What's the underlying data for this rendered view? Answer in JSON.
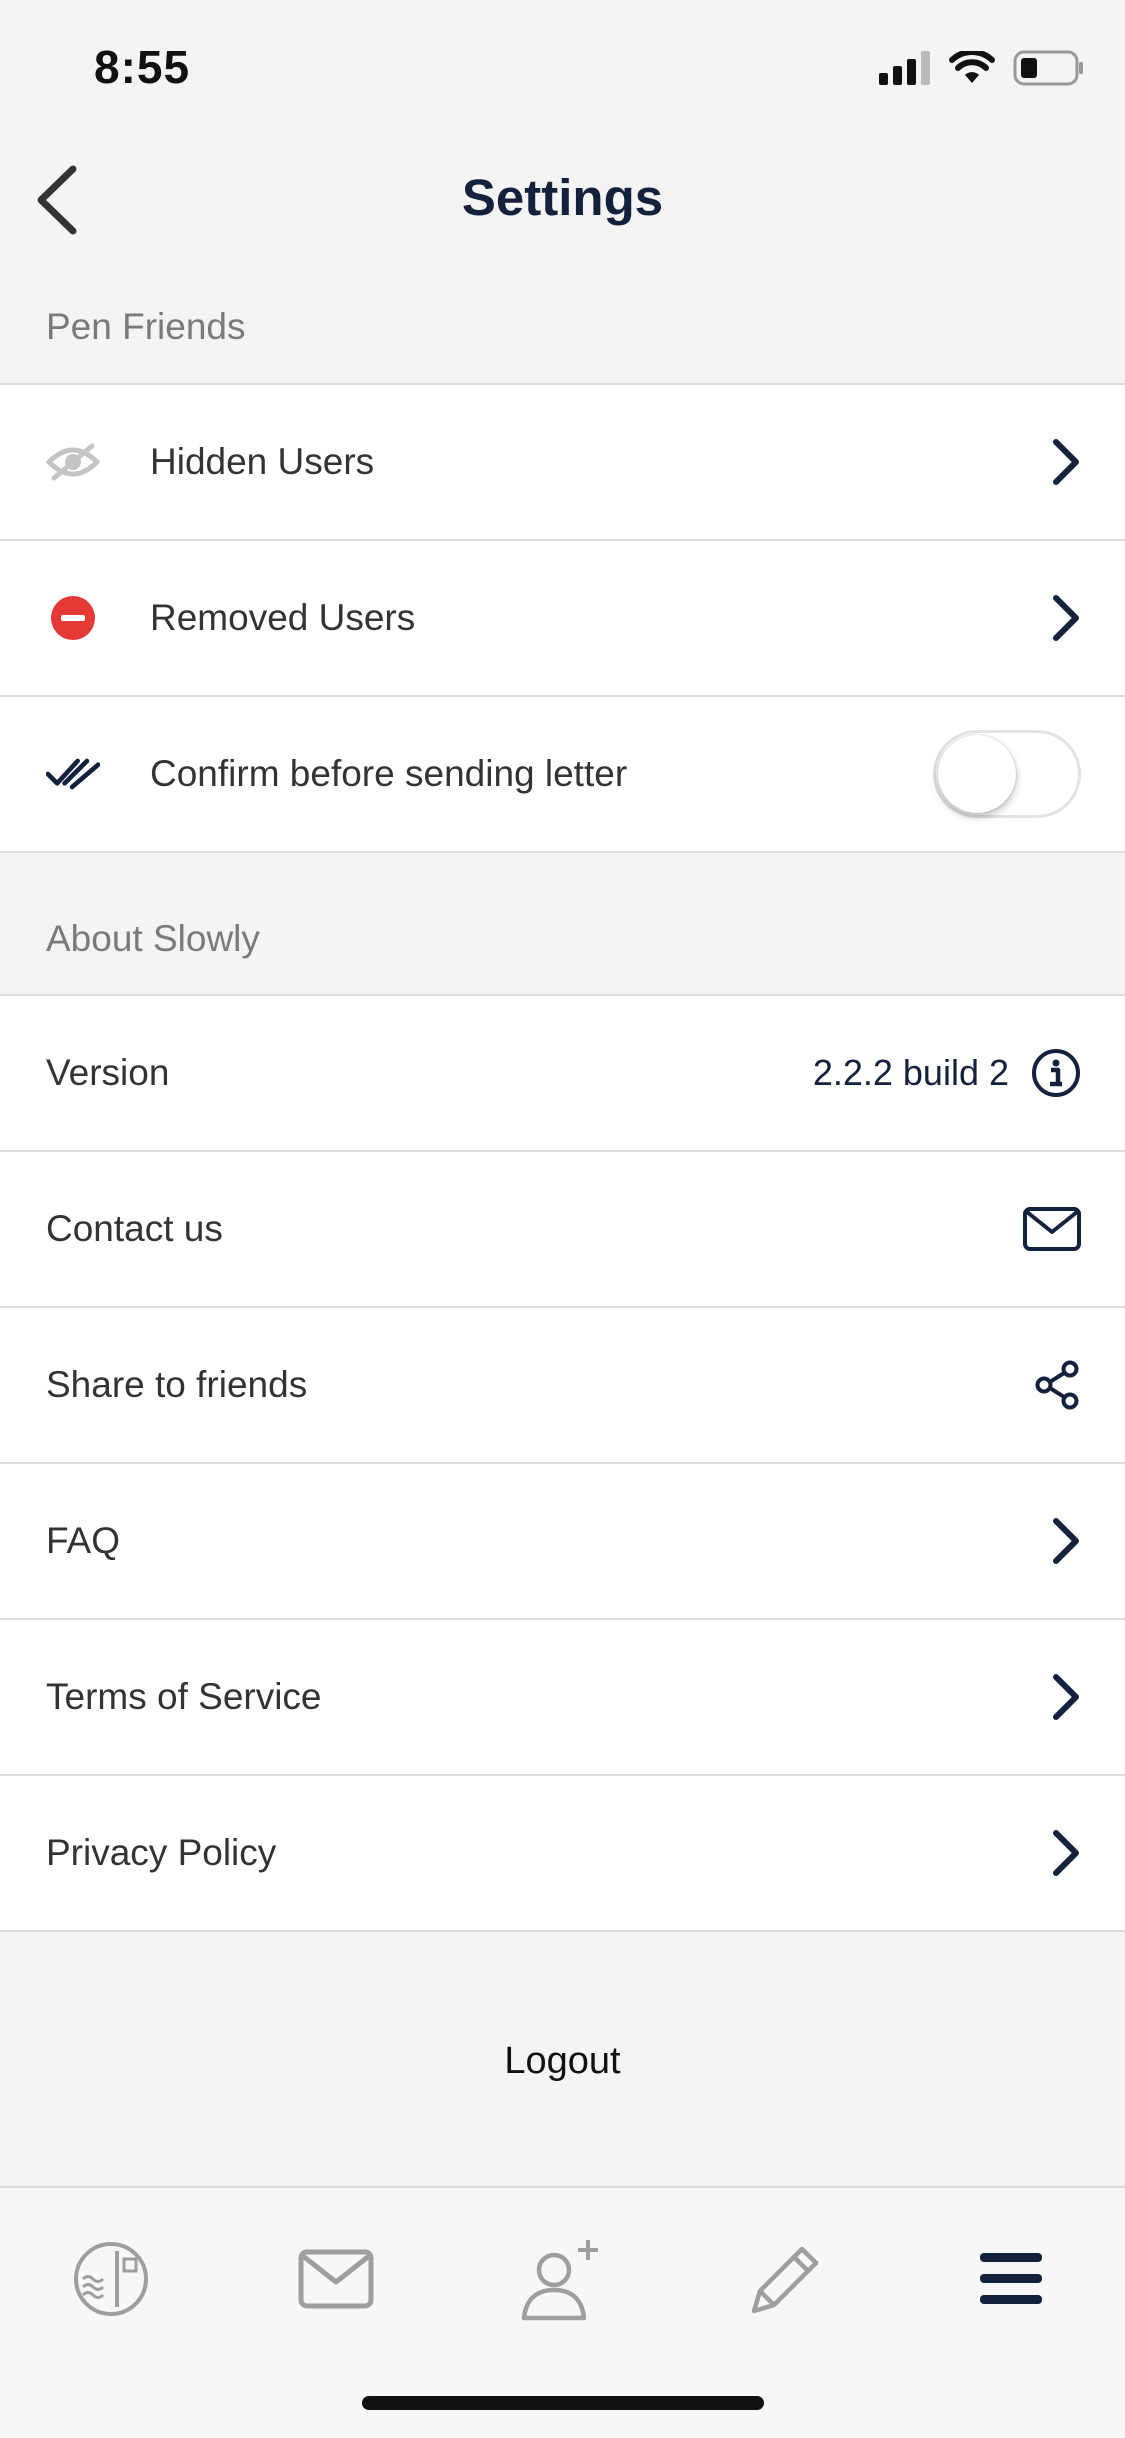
{
  "status": {
    "time": "8:55"
  },
  "nav": {
    "title": "Settings"
  },
  "pen_friends": {
    "header": "Pen Friends",
    "items": [
      {
        "label": "Hidden Users",
        "icon": "eye-slash-icon"
      },
      {
        "label": "Removed Users",
        "icon": "minus-circle-icon"
      },
      {
        "label": "Confirm before sending letter",
        "icon": "double-check-icon",
        "toggle_on": false
      }
    ]
  },
  "about": {
    "header": "About Slowly",
    "items": [
      {
        "label": "Version",
        "value": "2.2.2 build 2",
        "icon": "info-icon"
      },
      {
        "label": "Contact us",
        "icon": "envelope-icon"
      },
      {
        "label": "Share to friends",
        "icon": "share-icon"
      },
      {
        "label": "FAQ",
        "icon": "chevron-right-icon"
      },
      {
        "label": "Terms of Service",
        "icon": "chevron-right-icon"
      },
      {
        "label": "Privacy Policy",
        "icon": "chevron-right-icon"
      }
    ]
  },
  "logout": {
    "label": "Logout"
  },
  "tabs": [
    "stamp-icon",
    "mail-icon",
    "add-friend-icon",
    "pencil-icon",
    "menu-icon"
  ],
  "colors": {
    "navy": "#14213d",
    "red": "#e53935",
    "gray": "#bdbdbd"
  }
}
